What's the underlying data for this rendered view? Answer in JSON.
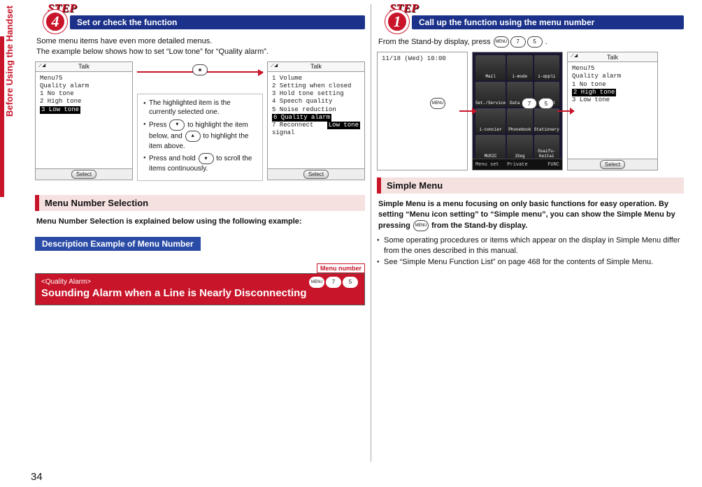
{
  "side_tab": "Before Using the Handset",
  "page_number": "34",
  "left": {
    "step_label": "STEP",
    "step_num": "4",
    "step_title": "Set or check the function",
    "intro1": "Some menu items have even more detailed menus.",
    "intro2": "The example below shows how to set “Low tone” for “Quality alarm”.",
    "phoneA": {
      "talk": "Talk",
      "l1": "Menu75",
      "l2": "Quality alarm",
      "opt1": "1 No tone",
      "opt2": "2 High tone",
      "opt3": "3 Low tone",
      "select": "Select"
    },
    "notes": {
      "n1_a": "The highlighted item is the currently selected one.",
      "n2_a": "Press ",
      "n2_b": " to highlight the item below, and ",
      "n2_c": " to highlight the item above.",
      "n3_a": "Press and hold ",
      "n3_b": " to scroll the items continuously."
    },
    "phoneB": {
      "talk": "Talk",
      "items": [
        "1 Volume",
        "2 Setting when closed",
        "3 Hold tone setting",
        "4 Speech quality",
        "5 Noise reduction",
        "6 Quality alarm",
        "7 Reconnect signal"
      ],
      "hl_right": "Low tone",
      "select": "Select"
    },
    "pink_head": "Menu Number Selection",
    "mns_line": "Menu Number Selection is explained below using the following example:",
    "blue_sub": "Description Example of Menu Number",
    "menu_number_label": "Menu number",
    "card": {
      "sub": "<Quality Alarm>",
      "title": "Sounding Alarm when a Line is Nearly Disconnecting",
      "menu": "MENU",
      "k7": "7",
      "k5": "5"
    }
  },
  "right": {
    "step_label": "STEP",
    "step_num": "1",
    "step_title": "Call up the function using the menu number",
    "line_a": "From the Stand-by display, press ",
    "menu": "MENU",
    "k7": "7",
    "k5": "5",
    "period": ".",
    "phoneA_time": "11/18 (Wed) 10:00",
    "menu_cells": [
      "Mail",
      "i-mode",
      "i-αppli",
      "Set./Service",
      "Data box",
      "LifeKit",
      "i-concier",
      "Phonebook",
      "Stationery",
      "MUSIC",
      "1Seg",
      "Osaifu-Keitai"
    ],
    "menu_bottom": [
      "Menu set",
      "Private",
      "FUNC"
    ],
    "phoneC": {
      "talk": "Talk",
      "l1": "Menu75",
      "l2": "Quality alarm",
      "o1": "1 No tone",
      "o2": "2 High tone",
      "o3": "3 Low tone",
      "select": "Select"
    },
    "pink_head": "Simple Menu",
    "para_strong": "Simple Menu is a menu focusing on only basic functions for easy operation. By setting “Menu icon setting” to “Simple menu”, you can show the Simple Menu by pressing ",
    "para_strong_tail": " from the Stand-by display.",
    "b1": "Some operating procedures or items which appear on the display in Simple Menu differ from the ones described in this manual.",
    "b2": "See “Simple Menu Function List” on page 468 for the contents of Simple Menu."
  }
}
